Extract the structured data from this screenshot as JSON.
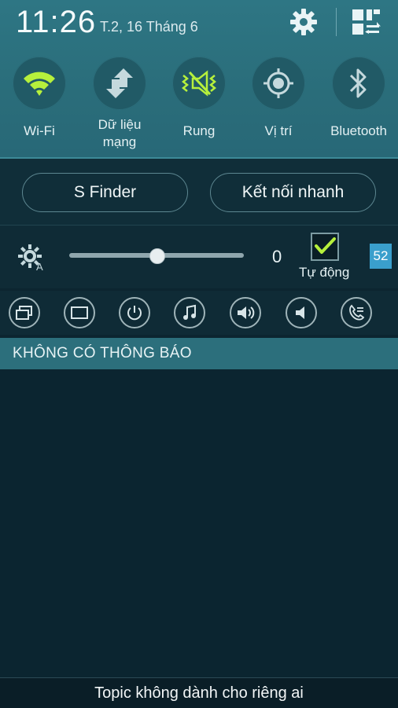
{
  "status": {
    "time": "11:26",
    "date": "T.2, 16 Tháng 6"
  },
  "header": {
    "settings_icon": "gear-icon",
    "edit_icon": "grid-edit-icon"
  },
  "toggles": [
    {
      "label": "Wi-Fi",
      "icon": "wifi-icon",
      "active": true
    },
    {
      "label": "Dữ liệu mạng",
      "label_line1": "Dữ liệu",
      "label_line2": "mạng",
      "icon": "data-transfer-icon",
      "active": false
    },
    {
      "label": "Rung",
      "icon": "vibrate-icon",
      "active": true
    },
    {
      "label": "Vị trí",
      "icon": "location-icon",
      "active": false
    },
    {
      "label": "Bluetooth",
      "icon": "bluetooth-icon",
      "active": false
    }
  ],
  "quick": {
    "sfinder": "S Finder",
    "quick_connect": "Kết nối nhanh"
  },
  "brightness": {
    "value": "0",
    "level": 0.5,
    "auto_label": "Tự động",
    "auto_checked": true,
    "badge": "52"
  },
  "shortcuts": [
    {
      "icon": "multi-window-icon"
    },
    {
      "icon": "screen-icon"
    },
    {
      "icon": "power-icon"
    },
    {
      "icon": "music-note-icon"
    },
    {
      "icon": "volume-up-icon"
    },
    {
      "icon": "volume-icon"
    },
    {
      "icon": "call-forward-icon"
    }
  ],
  "notifications": {
    "header": "KHÔNG CÓ THÔNG BÁO"
  },
  "footer": {
    "text": "Topic không dành cho riêng ai"
  },
  "colors": {
    "accent_green": "#b6f03c",
    "panel_teal": "#2a6d7a"
  }
}
